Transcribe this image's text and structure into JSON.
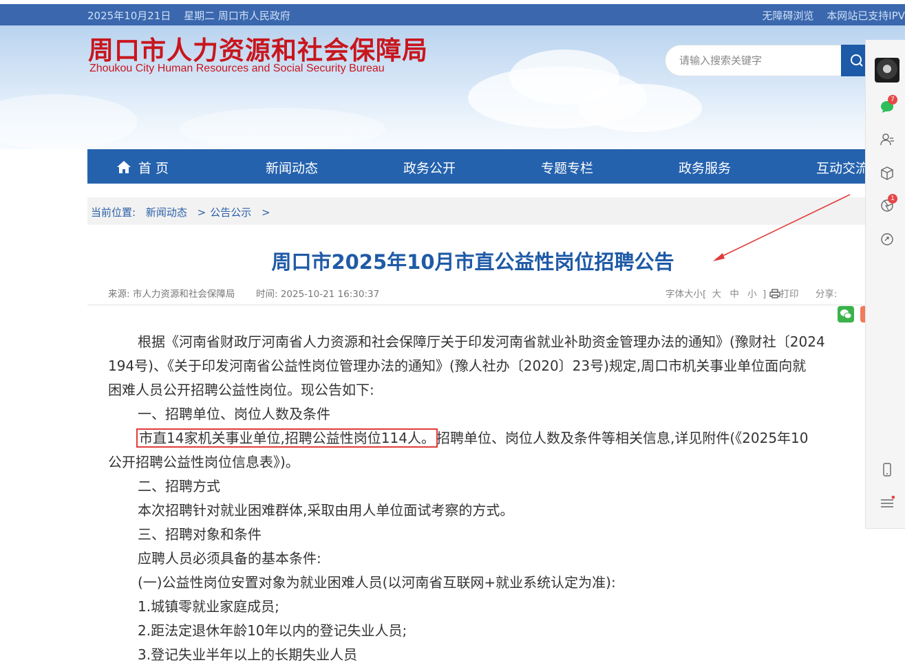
{
  "topbar": {
    "date": "2025年10月21日",
    "weekday_gov": "星期二 周口市人民政府",
    "accessibility": "无障碍浏览",
    "ipv6": "本网站已支持IPV"
  },
  "header": {
    "title": "周口市人力资源和社会保障局",
    "subtitle": "Zhoukou City Human Resources and Social Security Bureau",
    "search_placeholder": "请输入搜索关键字"
  },
  "nav": {
    "items": [
      "首 页",
      "新闻动态",
      "政务公开",
      "专题专栏",
      "政务服务",
      "互动交流"
    ]
  },
  "breadcrumb": {
    "label": "当前位置:",
    "items": [
      "新闻动态",
      "公告公示"
    ],
    "separator": ">"
  },
  "article": {
    "title": "周口市2025年10月市直公益性岗位招聘公告",
    "source_label": "来源:",
    "source": "市人力资源和社会保障局",
    "time_label": "时间:",
    "time": "2025-10-21 16:30:37",
    "font_size_label": "字体大小[",
    "font_large": "大",
    "font_medium": "中",
    "font_small": "小",
    "font_end": "]",
    "print": "打印",
    "share": "分享:",
    "paragraphs": [
      "根据《河南省财政厅河南省人力资源和社会保障厅关于印发河南省就业补助资金管理办法的通知》(豫财社〔2024",
      "194号)、《关于印发河南省公益性岗位管理办法的通知》(豫人社办〔2020〕23号)规定,周口市机关事业单位面向就",
      "困难人员公开招聘公益性岗位。现公告如下:",
      "一、招聘单位、岗位人数及条件",
      "市直14家机关事业单位,招聘公益性岗位114人。",
      "招聘单位、岗位人数及条件等相关信息,详见附件(《2025年10",
      "公开招聘公益性岗位信息表》)。",
      "二、招聘方式",
      "本次招聘针对就业困难群体,采取由用人单位面试考察的方式。",
      "三、招聘对象和条件",
      "应聘人员必须具备的基本条件:",
      "(一)公益性岗位安置对象为就业困难人员(以河南省互联网+就业系统认定为准):",
      "1.城镇零就业家庭成员;",
      "2.距法定退休年龄10年以内的登记失业人员;",
      "3.登记失业半年以上的长期失业人员"
    ]
  },
  "right_toolbar": {
    "chat_badge": "7",
    "share_badge": "1"
  },
  "colors": {
    "topbar": "#3a67ad",
    "nav": "#2562ae",
    "title_red": "#c8161d",
    "article_title": "#1f5aa6",
    "highlight": "#e03b3b"
  }
}
